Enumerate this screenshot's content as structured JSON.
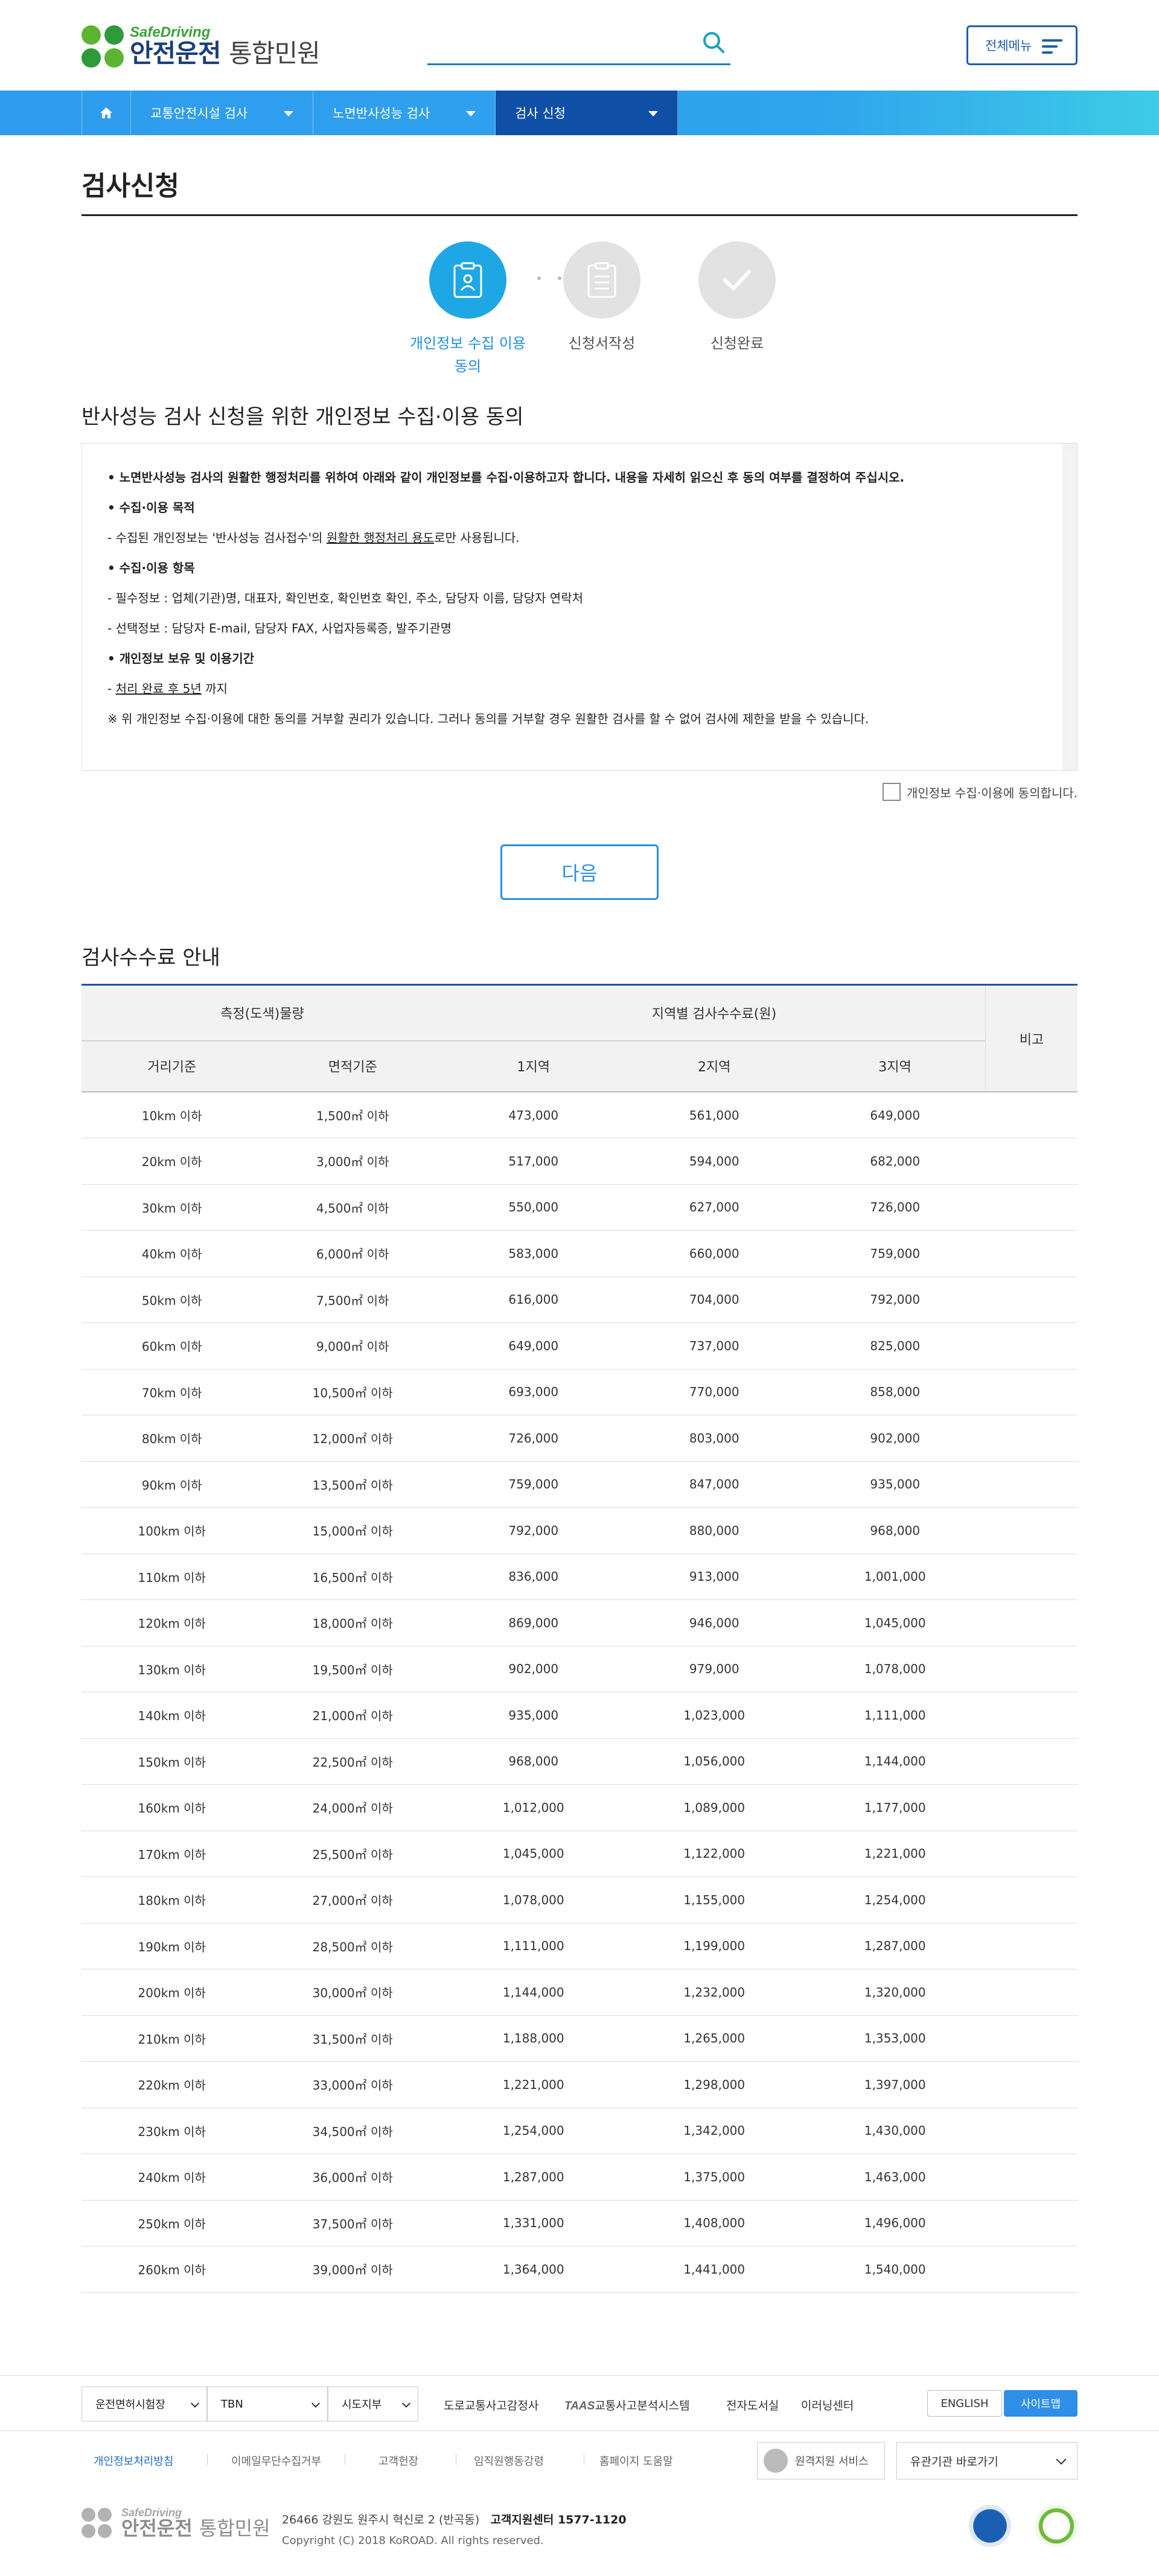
{
  "header": {
    "logo_en": "SafeDriving",
    "logo_ko_bold": "안전운전",
    "logo_ko_light": "통합민원",
    "search_placeholder": "",
    "all_menu_label": "전체메뉴"
  },
  "nav": {
    "items": [
      {
        "label": "교통안전시설 검사"
      },
      {
        "label": "노면반사성능 검사"
      },
      {
        "label": "검사 신청"
      }
    ]
  },
  "page_title": "검사신청",
  "steps": [
    {
      "label": "개인정보 수집 이용\n동의"
    },
    {
      "label": "신청서작성"
    },
    {
      "label": "신청완료"
    }
  ],
  "consent": {
    "title": "반사성능 검사 신청을 위한 개인정보 수집·이용 동의",
    "intro": "노면반사성능 검사의 원활한 행정처리를 위하여 아래와 같이 개인정보를 수집·이용하고자 합니다. 내용을 자세히 읽으신 후 동의 여부를 결정하여 주십시오.",
    "purpose_head": "수집·이용 목적",
    "purpose_pre": "- 수집된 개인정보는 '반사성능 검사접수'의 ",
    "purpose_u": "원활한 행정처리 용도",
    "purpose_post": "로만 사용됩니다.",
    "items_head": "수집·이용 항목",
    "items_required": "- 필수정보 : 업체(기관)명, 대표자, 확인번호, 확인번호 확인, 주소, 담당자 이름, 담당자 연락처",
    "items_optional": "- 선택정보 : 담당자 E-mail, 담당자 FAX, 사업자등록증, 발주기관명",
    "retention_head": "개인정보 보유 및 이용기간",
    "retention_pre": "- ",
    "retention_u": "처리 완료 후 5년",
    "retention_post": " 까지",
    "notice": "※ 위 개인정보 수집·이용에 대한 동의를 거부할 권리가 있습니다. 그러나 동의를 거부할 경우 원활한 검사를 할 수 없어 검사에 제한을 받을 수 있습니다.",
    "agree_label": "개인정보 수집·이용에 동의합니다."
  },
  "next_button": "다음",
  "fee": {
    "title": "검사수수료 안내",
    "head_measure": "측정(도색)물량",
    "head_region": "지역별 검사수수료(원)",
    "head_note": "비고",
    "head_distance": "거리기준",
    "head_area": "면적기준",
    "head_r1": "1지역",
    "head_r2": "2지역",
    "head_r3": "3지역",
    "rows": [
      [
        "10km 이하",
        "1,500㎡ 이하",
        "473,000",
        "561,000",
        "649,000",
        ""
      ],
      [
        "20km 이하",
        "3,000㎡ 이하",
        "517,000",
        "594,000",
        "682,000",
        ""
      ],
      [
        "30km 이하",
        "4,500㎡ 이하",
        "550,000",
        "627,000",
        "726,000",
        ""
      ],
      [
        "40km 이하",
        "6,000㎡ 이하",
        "583,000",
        "660,000",
        "759,000",
        ""
      ],
      [
        "50km 이하",
        "7,500㎡ 이하",
        "616,000",
        "704,000",
        "792,000",
        ""
      ],
      [
        "60km 이하",
        "9,000㎡ 이하",
        "649,000",
        "737,000",
        "825,000",
        ""
      ],
      [
        "70km 이하",
        "10,500㎡ 이하",
        "693,000",
        "770,000",
        "858,000",
        ""
      ],
      [
        "80km 이하",
        "12,000㎡ 이하",
        "726,000",
        "803,000",
        "902,000",
        ""
      ],
      [
        "90km 이하",
        "13,500㎡ 이하",
        "759,000",
        "847,000",
        "935,000",
        ""
      ],
      [
        "100km 이하",
        "15,000㎡ 이하",
        "792,000",
        "880,000",
        "968,000",
        ""
      ],
      [
        "110km 이하",
        "16,500㎡ 이하",
        "836,000",
        "913,000",
        "1,001,000",
        ""
      ],
      [
        "120km 이하",
        "18,000㎡ 이하",
        "869,000",
        "946,000",
        "1,045,000",
        ""
      ],
      [
        "130km 이하",
        "19,500㎡ 이하",
        "902,000",
        "979,000",
        "1,078,000",
        ""
      ],
      [
        "140km 이하",
        "21,000㎡ 이하",
        "935,000",
        "1,023,000",
        "1,111,000",
        ""
      ],
      [
        "150km 이하",
        "22,500㎡ 이하",
        "968,000",
        "1,056,000",
        "1,144,000",
        ""
      ],
      [
        "160km 이하",
        "24,000㎡ 이하",
        "1,012,000",
        "1,089,000",
        "1,177,000",
        ""
      ],
      [
        "170km 이하",
        "25,500㎡ 이하",
        "1,045,000",
        "1,122,000",
        "1,221,000",
        ""
      ],
      [
        "180km 이하",
        "27,000㎡ 이하",
        "1,078,000",
        "1,155,000",
        "1,254,000",
        ""
      ],
      [
        "190km 이하",
        "28,500㎡ 이하",
        "1,111,000",
        "1,199,000",
        "1,287,000",
        ""
      ],
      [
        "200km 이하",
        "30,000㎡ 이하",
        "1,144,000",
        "1,232,000",
        "1,320,000",
        ""
      ],
      [
        "210km 이하",
        "31,500㎡ 이하",
        "1,188,000",
        "1,265,000",
        "1,353,000",
        ""
      ],
      [
        "220km 이하",
        "33,000㎡ 이하",
        "1,221,000",
        "1,298,000",
        "1,397,000",
        ""
      ],
      [
        "230km 이하",
        "34,500㎡ 이하",
        "1,254,000",
        "1,342,000",
        "1,430,000",
        ""
      ],
      [
        "240km 이하",
        "36,000㎡ 이하",
        "1,287,000",
        "1,375,000",
        "1,463,000",
        ""
      ],
      [
        "250km 이하",
        "37,500㎡ 이하",
        "1,331,000",
        "1,408,000",
        "1,496,000",
        ""
      ],
      [
        "260km 이하",
        "39,000㎡ 이하",
        "1,364,000",
        "1,441,000",
        "1,540,000",
        ""
      ]
    ]
  },
  "footer": {
    "select1": "운전면허시험장",
    "select2": "TBN",
    "select3": "시도지부",
    "link1": "도로교통사고감정사",
    "link2_logo": "TAAS",
    "link2": "교통사고분석시스템",
    "link3": "전자도서실",
    "link4": "이러닝센터",
    "english": "ENGLISH",
    "sitemap": "사이트맵",
    "policy1": "개인정보처리방침",
    "policy2": "이메일무단수집거부",
    "policy3": "고객헌장",
    "policy4": "임직원행동강령",
    "policy5": "홈페이지 도움말",
    "remote": "원격지원 서비스",
    "related": "유관기관 바로가기",
    "address": "26466 강원도 원주시 혁신로 2 (반곡동)",
    "callcenter": "고객지원센터 1577-1120",
    "copyright": "Copyright (C) 2018 KoROAD. All rights reserved."
  },
  "colors": {
    "nav_gradient_start": "#2f9cee",
    "nav_active": "#0f4fa6",
    "accent": "#2a8fe0",
    "step_active": "#1ea7e4"
  }
}
